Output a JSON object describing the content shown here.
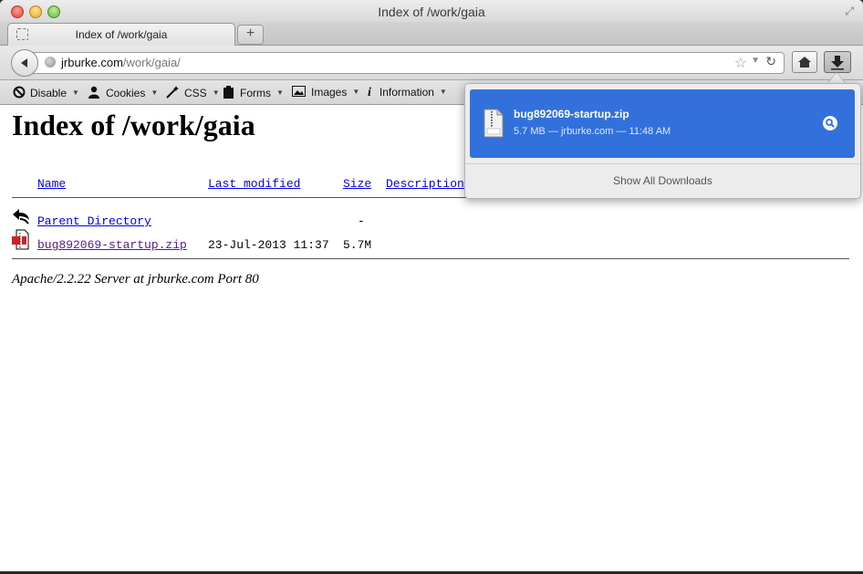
{
  "window": {
    "title": "Index of /work/gaia"
  },
  "tab": {
    "label": "Index of /work/gaia",
    "new_tab_label": "+"
  },
  "urlbar": {
    "host": "jrburke.com",
    "path": "/work/gaia/"
  },
  "bookmarks": [
    {
      "label": "Disable",
      "icon": "no-entry-icon"
    },
    {
      "label": "Cookies",
      "icon": "person-icon"
    },
    {
      "label": "CSS",
      "icon": "magic-wand-icon"
    },
    {
      "label": "Forms",
      "icon": "clipboard-icon"
    },
    {
      "label": "Images",
      "icon": "image-icon"
    },
    {
      "label": "Information",
      "icon": "info-icon"
    }
  ],
  "page": {
    "title": "Index of /work/gaia",
    "columns": {
      "name": "Name",
      "last_modified": "Last modified",
      "size": "Size",
      "description": "Description"
    },
    "rows": [
      {
        "name": "Parent Directory",
        "last_modified": "",
        "size": "-",
        "icon": "back-arrow-icon"
      },
      {
        "name": "bug892069-startup.zip",
        "last_modified": "23-Jul-2013 11:37",
        "size": "5.7M",
        "icon": "zip-file-icon"
      }
    ],
    "footer": "Apache/2.2.22 Server at jrburke.com Port 80"
  },
  "downloads": {
    "item": {
      "name": "bug892069-startup.zip",
      "status": "5.7 MB — jrburke.com — 11:48 AM"
    },
    "show_all": "Show All Downloads"
  },
  "colors": {
    "download_highlight": "#3271db",
    "link": "#0000ee",
    "visited": "#551a8b"
  }
}
